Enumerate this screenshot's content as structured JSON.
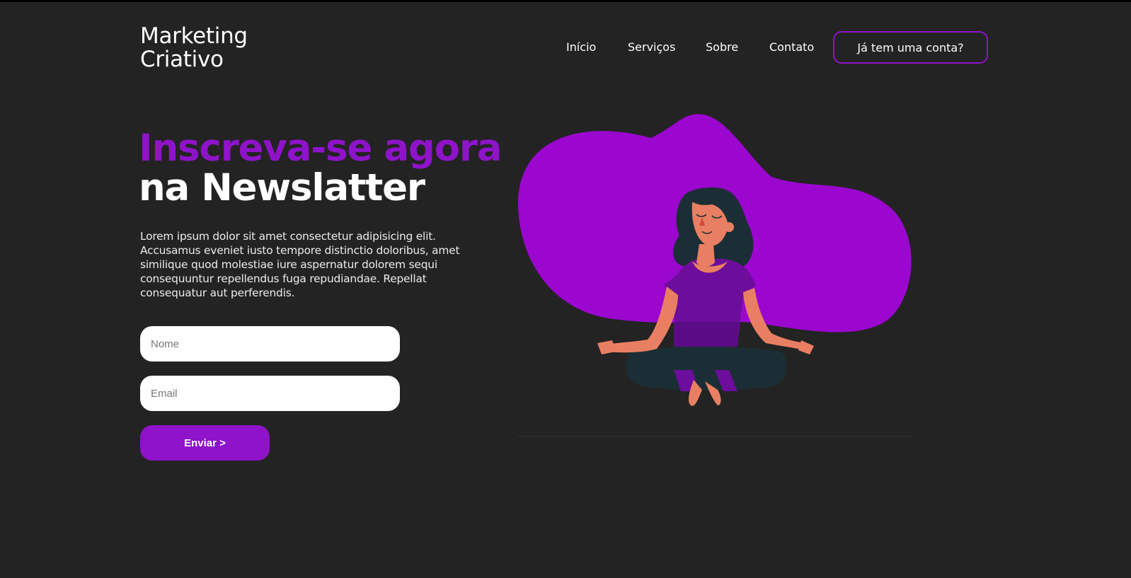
{
  "brand": {
    "line1": "Marketing",
    "line2": "Criativo"
  },
  "nav": {
    "items": [
      {
        "label": "Início"
      },
      {
        "label": "Serviços"
      },
      {
        "label": "Sobre"
      },
      {
        "label": "Contato"
      }
    ],
    "login_label": "Já tem uma conta?"
  },
  "hero": {
    "title_line1": "Inscreva-se agora",
    "title_line2": "na Newslatter",
    "description": "Lorem ipsum dolor sit amet consectetur adipisicing elit. Accusamus eveniet iusto tempore distinctio doloribus, amet similique quod molestiae iure aspernatur dolorem sequi consequuntur repellendus fuga repudiandae. Repellat consequatur aut perferendis."
  },
  "form": {
    "name_placeholder": "Nome",
    "email_placeholder": "Email",
    "submit_label": "Enviar >"
  },
  "illustration": {
    "icon": "meditating-woman-illustration"
  },
  "colors": {
    "background": "#232323",
    "accent": "#8e13c9",
    "blob": "#9b07cf",
    "text": "#ffffff"
  }
}
